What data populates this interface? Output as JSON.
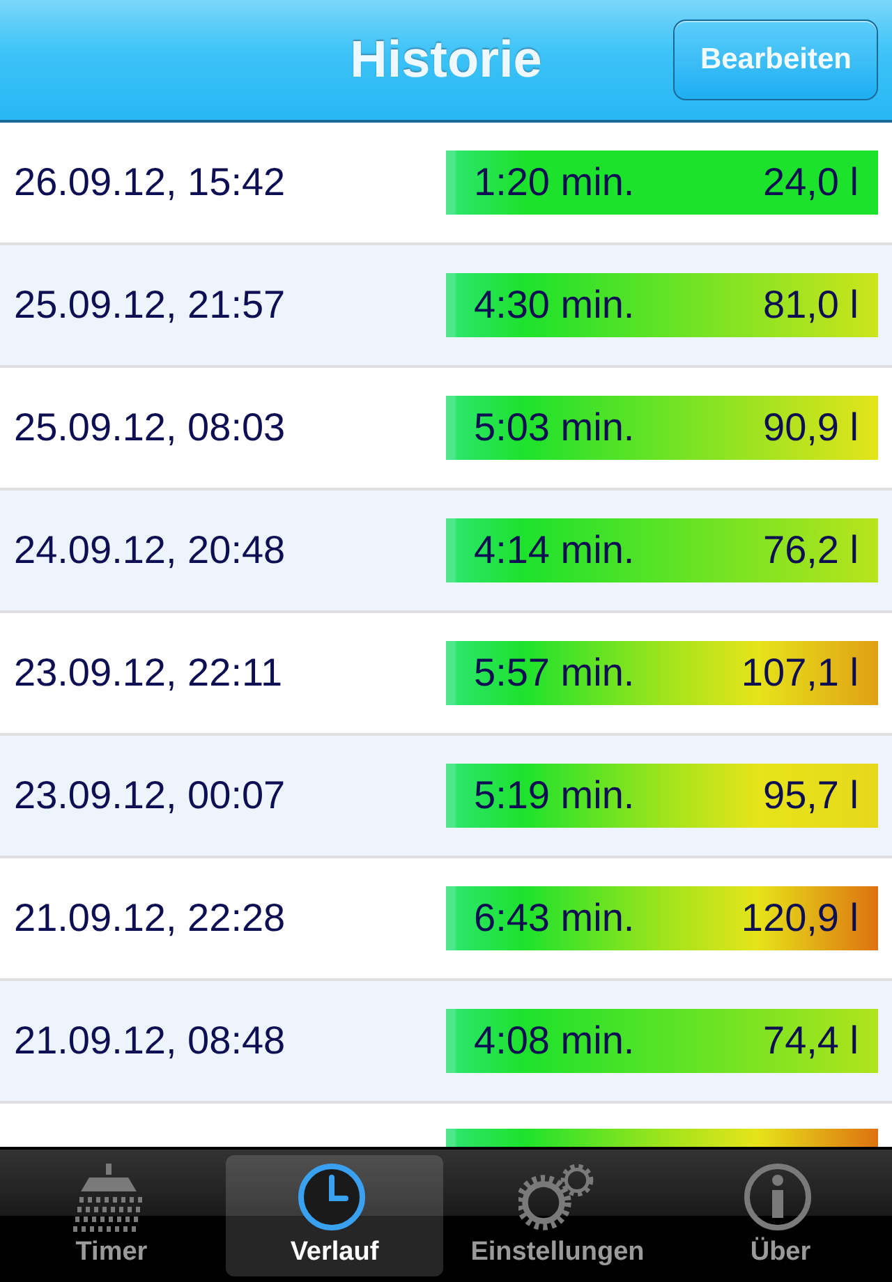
{
  "nav_bar": {
    "title": "Historie",
    "button": "Bearbeiten"
  },
  "rows": [
    {
      "date": "26.09.12, 15:42",
      "duration": "1:20 min.",
      "volume": "24,0 l",
      "color": "#1de22c"
    },
    {
      "date": "25.09.12, 21:57",
      "duration": "4:30 min.",
      "volume": "81,0 l",
      "color": "#cce41c"
    },
    {
      "date": "25.09.12, 08:03",
      "duration": "5:03 min.",
      "volume": "90,9 l",
      "color": "#e4e41a"
    },
    {
      "date": "24.09.12, 20:48",
      "duration": "4:14 min.",
      "volume": "76,2 l",
      "color": "#b8e41c"
    },
    {
      "date": "23.09.12, 22:11",
      "duration": "5:57 min.",
      "volume": "107,1 l",
      "color": "#e0a014"
    },
    {
      "date": "23.09.12, 00:07",
      "duration": "5:19 min.",
      "volume": "95,7 l",
      "color": "#e6d81a"
    },
    {
      "date": "21.09.12, 22:28",
      "duration": "6:43 min.",
      "volume": "120,9 l",
      "color": "#dd7210"
    },
    {
      "date": "21.09.12, 08:48",
      "duration": "4:08 min.",
      "volume": "74,4 l",
      "color": "#b0e41c"
    },
    {
      "color": "#dd7210"
    }
  ],
  "tab_bar": [
    {
      "label": "Timer",
      "kind": "shower",
      "selected": false
    },
    {
      "label": "Verlauf",
      "kind": "clock",
      "selected": true
    },
    {
      "label": "Einstellungen",
      "kind": "gears",
      "selected": false
    },
    {
      "label": "Über",
      "kind": "info",
      "selected": false
    }
  ]
}
